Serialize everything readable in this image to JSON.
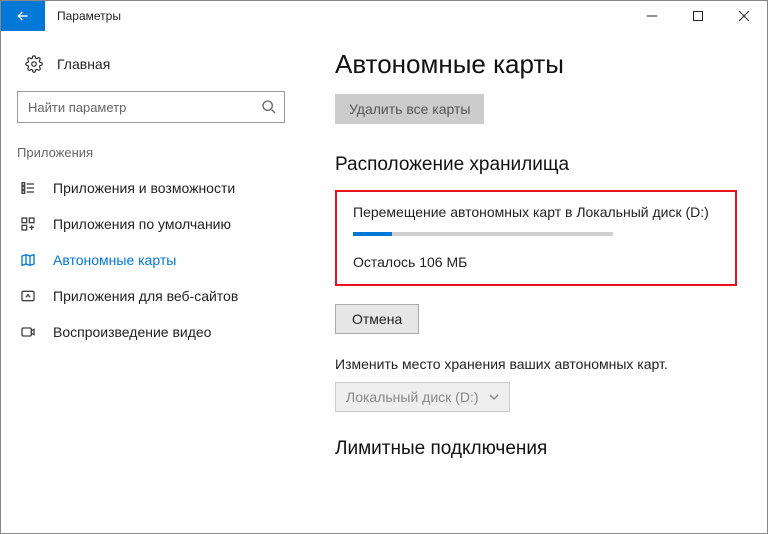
{
  "titlebar": {
    "title": "Параметры"
  },
  "sidebar": {
    "home": "Главная",
    "search_placeholder": "Найти параметр",
    "section": "Приложения",
    "items": [
      {
        "label": "Приложения и возможности"
      },
      {
        "label": "Приложения по умолчанию"
      },
      {
        "label": "Автономные карты"
      },
      {
        "label": "Приложения для веб-сайтов"
      },
      {
        "label": "Воспроизведение видео"
      }
    ]
  },
  "main": {
    "heading": "Автономные карты",
    "delete_maps_label": "Удалить все карты",
    "storage_heading": "Расположение хранилища",
    "moving_text": "Перемещение автономных карт в Локальный диск (D:)",
    "progress_percent": 15,
    "remaining_text": "Осталось 106 МБ",
    "cancel_label": "Отмена",
    "change_location_desc": "Изменить место хранения ваших автономных карт.",
    "location_dropdown_value": "Локальный диск (D:)",
    "metered_heading": "Лимитные подключения"
  }
}
